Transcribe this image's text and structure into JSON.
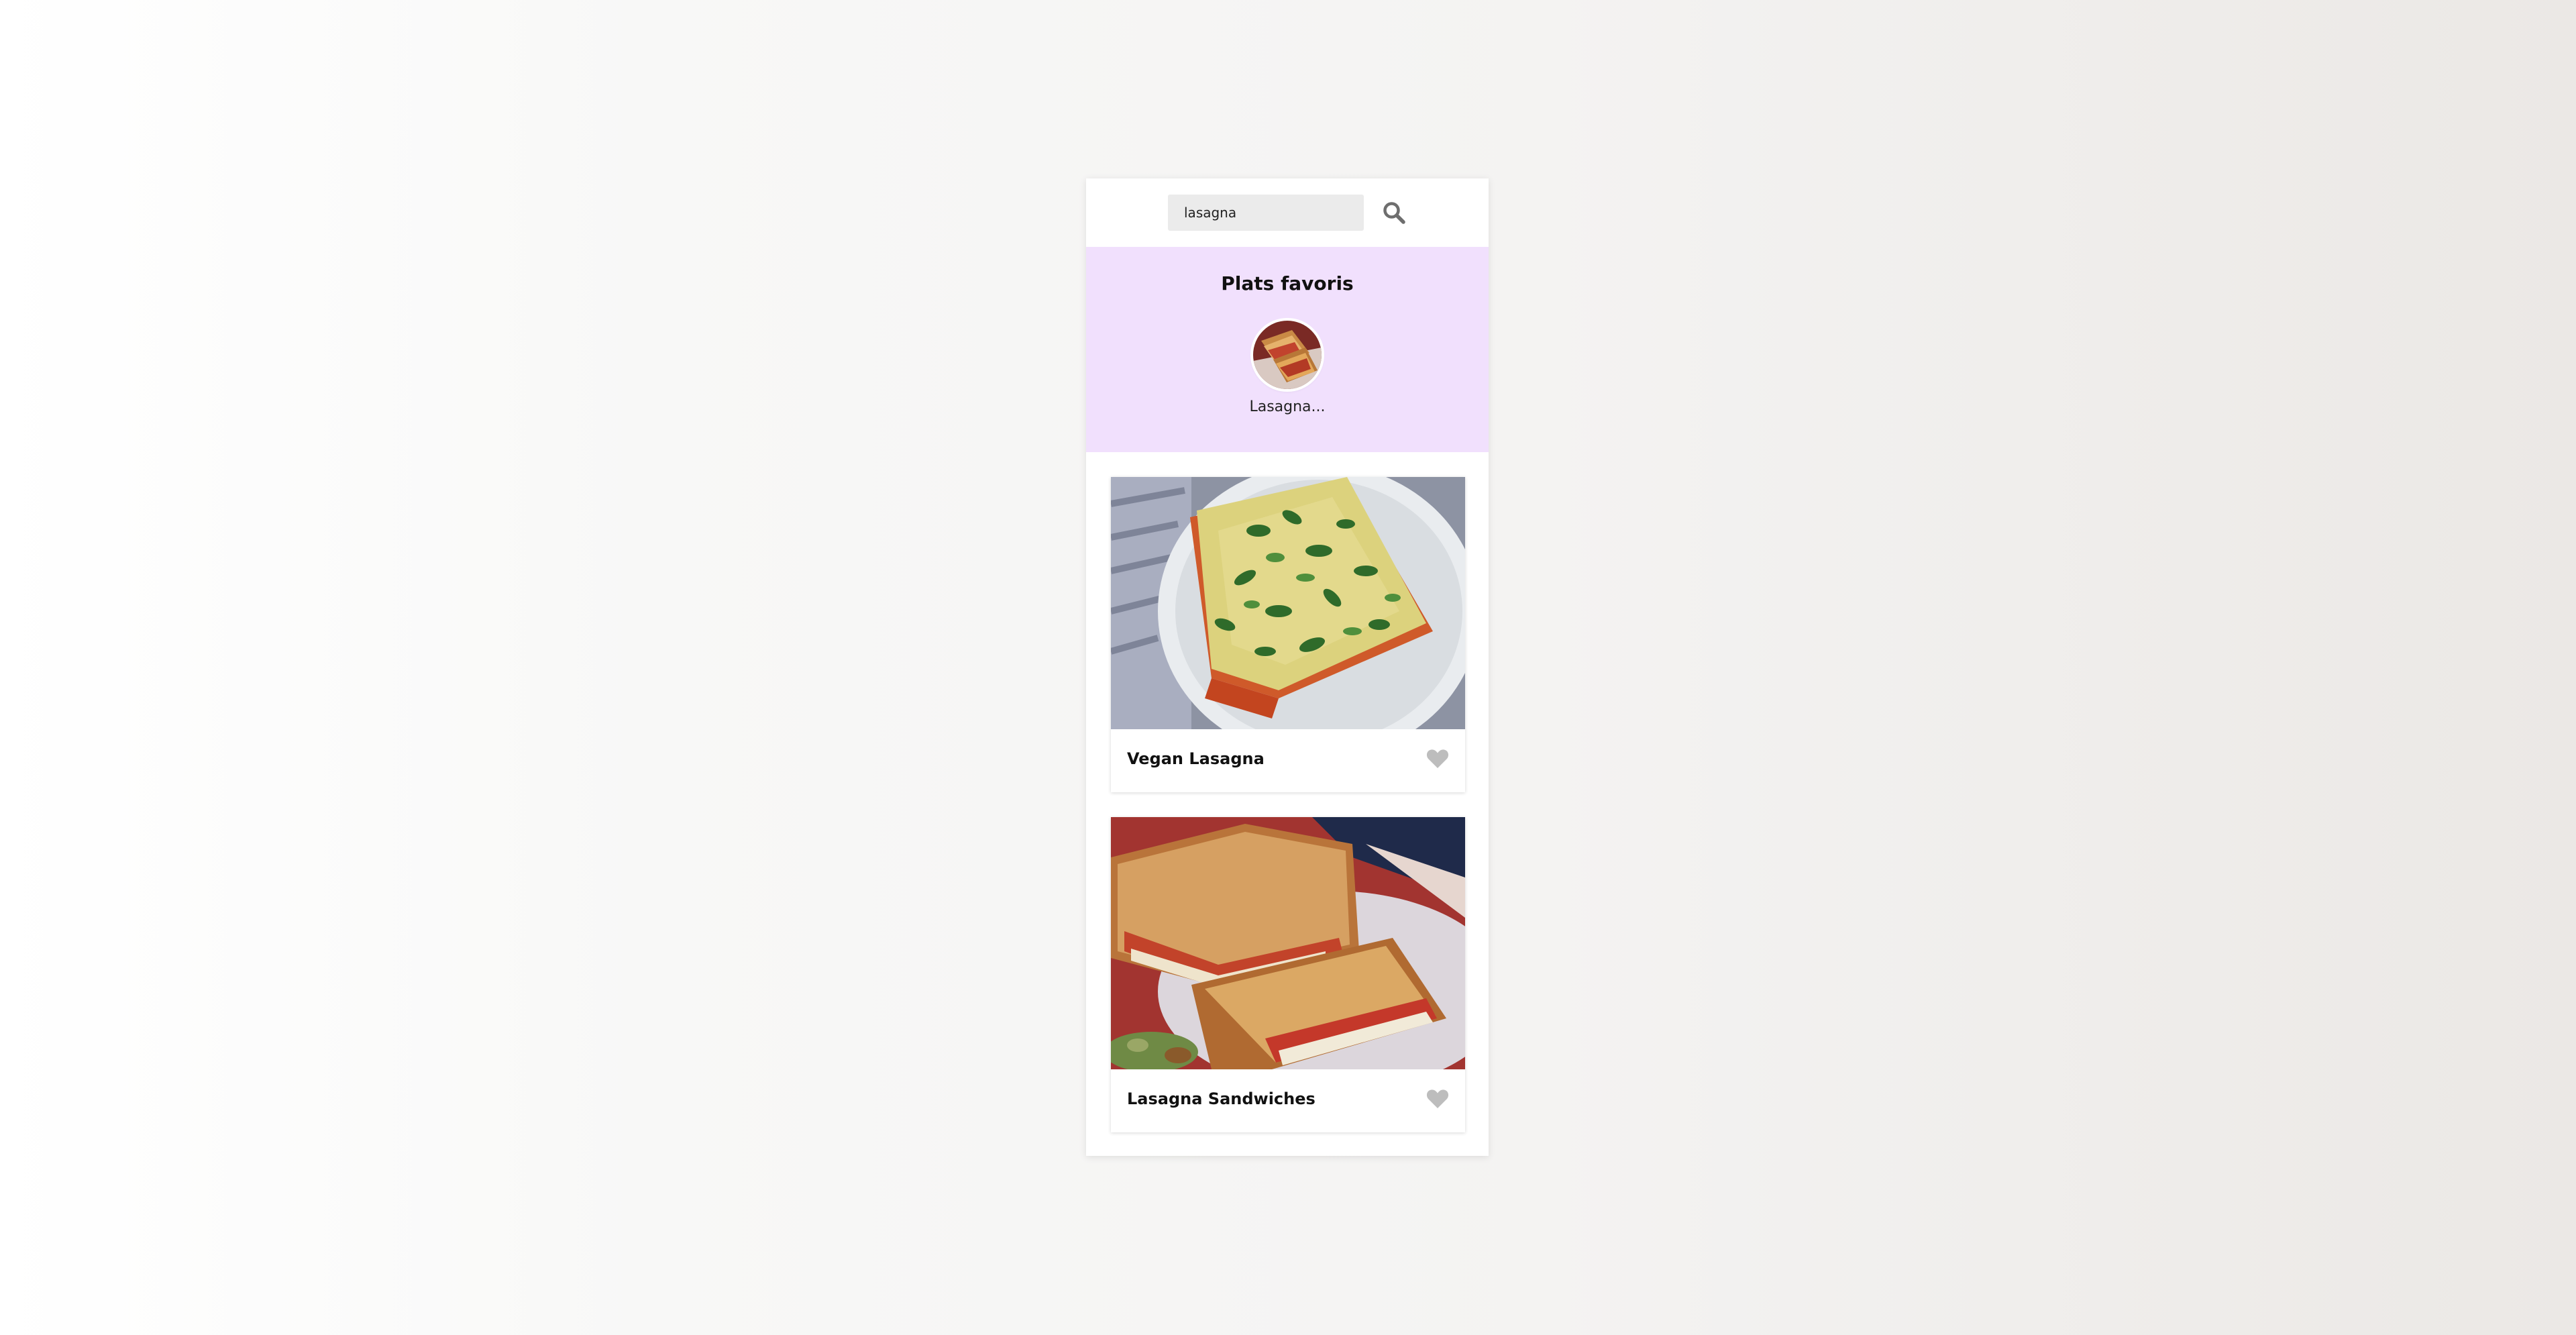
{
  "search": {
    "value": "lasagna",
    "icon": "search-icon"
  },
  "favorites": {
    "title": "Plats favoris",
    "items": [
      {
        "label": "Lasagna..."
      }
    ]
  },
  "recipes": [
    {
      "title": "Vegan Lasagna",
      "favorite_icon": "heart-icon",
      "favorited": false
    },
    {
      "title": "Lasagna Sandwiches",
      "favorite_icon": "heart-icon",
      "favorited": false
    }
  ],
  "colors": {
    "favorites_bg": "#f1e0fd",
    "search_bg": "#ebebeb",
    "heart_inactive": "#bdbdbd",
    "icon": "#6e6e6e"
  }
}
